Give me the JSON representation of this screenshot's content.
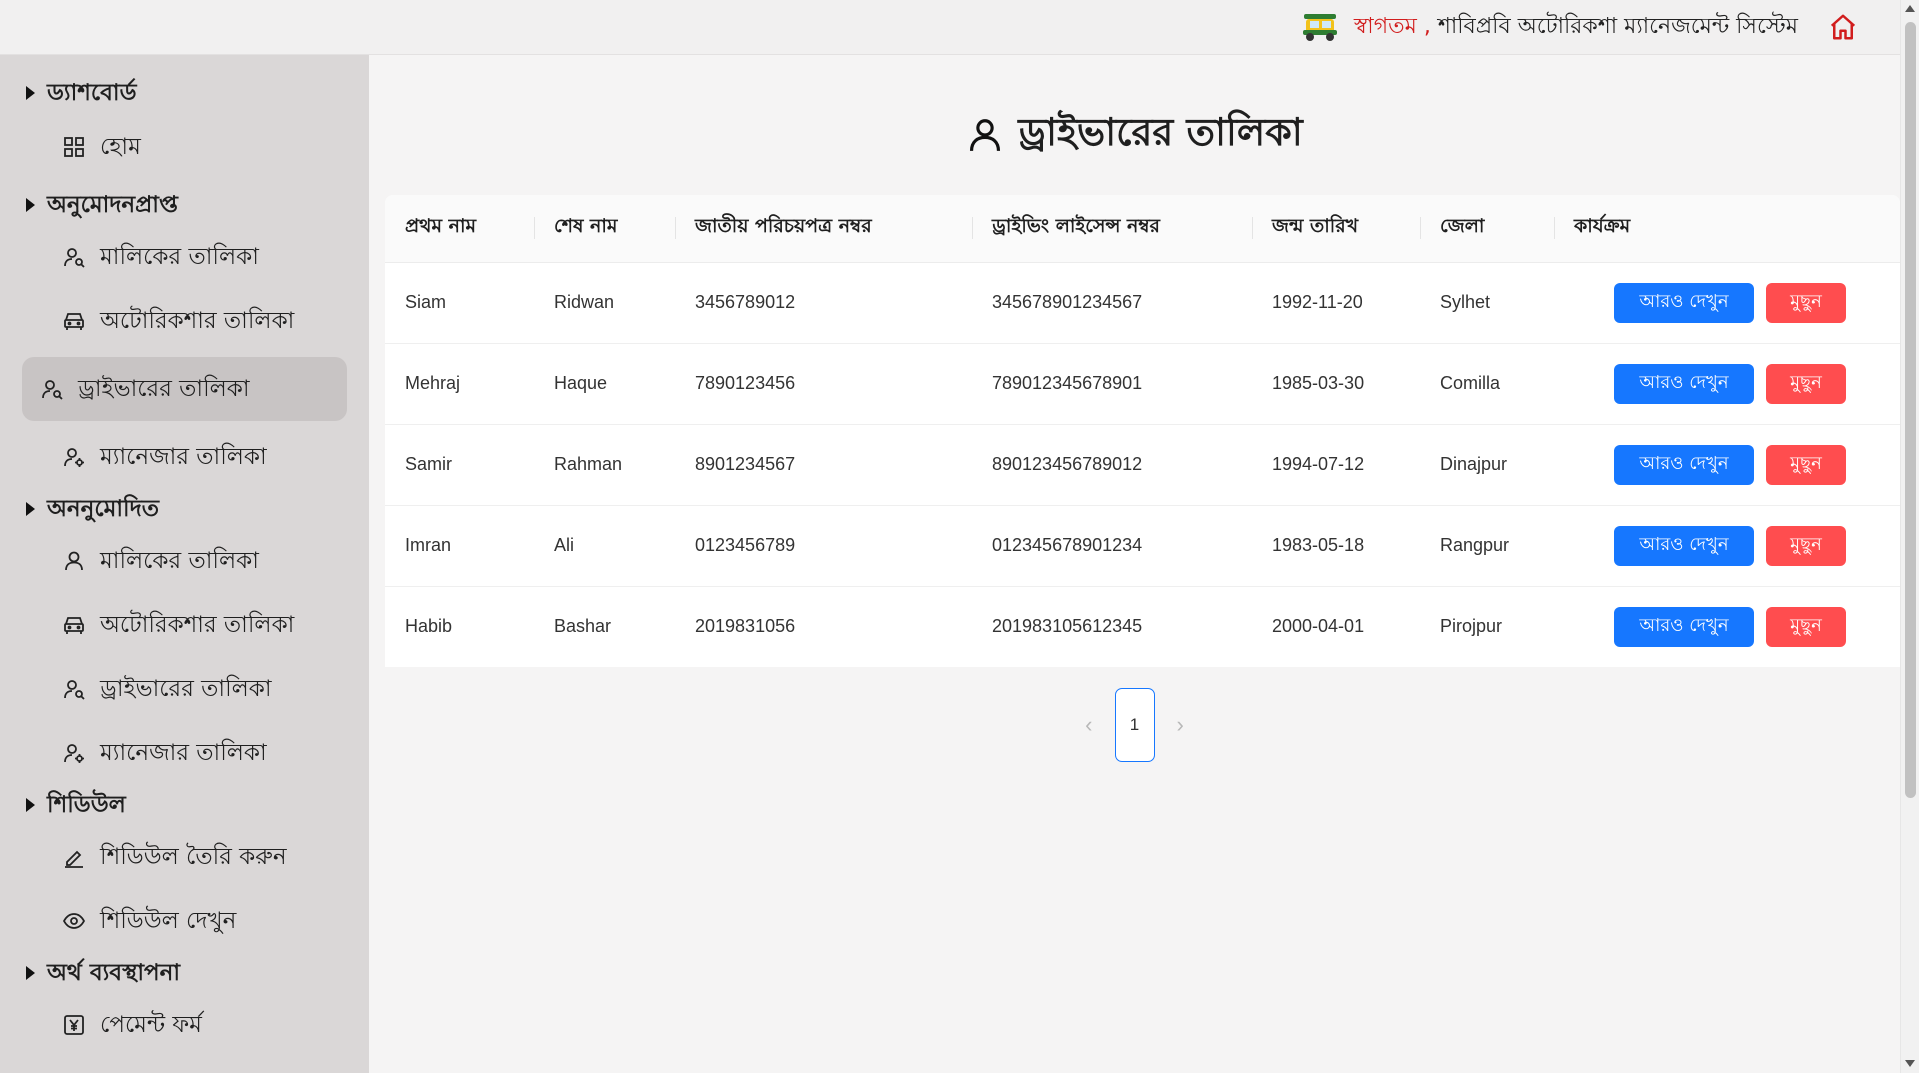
{
  "header": {
    "welcome": "স্বাগতম ,",
    "system_name": "শাবিপ্রবি অটোরিকশা ম্যানেজমেন্ট সিস্টেম",
    "rickshaw_icon": "rickshaw-icon",
    "home_icon": "home-icon",
    "accent_color": "#d11d1d"
  },
  "sidebar": {
    "groups": [
      {
        "title": "ড্যাশবোর্ড",
        "items": [
          {
            "label": "হোম",
            "icon": "grid-icon"
          }
        ]
      },
      {
        "title": "অনুমোদনপ্রাপ্ত",
        "items": [
          {
            "label": "মালিকের তালিকা",
            "icon": "user-search-icon"
          },
          {
            "label": "অটোরিকশার তালিকা",
            "icon": "car-icon"
          },
          {
            "label": "ড্রাইভারের তালিকা",
            "icon": "user-search-icon",
            "active": true
          },
          {
            "label": "ম্যানেজার তালিকা",
            "icon": "user-gear-icon"
          }
        ]
      },
      {
        "title": "অননুমোদিত",
        "items": [
          {
            "label": "মালিকের তালিকা",
            "icon": "user-icon"
          },
          {
            "label": "অটোরিকশার তালিকা",
            "icon": "car-icon"
          },
          {
            "label": "ড্রাইভারের তালিকা",
            "icon": "user-search-icon"
          },
          {
            "label": "ম্যানেজার তালিকা",
            "icon": "user-gear-icon"
          }
        ]
      },
      {
        "title": "শিডিউল",
        "items": [
          {
            "label": "শিডিউল তৈরি করুন",
            "icon": "edit-icon"
          },
          {
            "label": "শিডিউল দেখুন",
            "icon": "eye-icon"
          }
        ]
      },
      {
        "title": "অর্থ ব্যবস্থাপনা",
        "items": [
          {
            "label": "পেমেন্ট ফর্ম",
            "icon": "yen-icon"
          }
        ]
      }
    ]
  },
  "main": {
    "title": "ড্রাইভারের তালিকা",
    "title_icon": "user-icon",
    "columns": [
      "প্রথম নাম",
      "শেষ নাম",
      "জাতীয় পরিচয়পত্র নম্বর",
      "ড্রাইভিং লাইসেন্স নম্বর",
      "জন্ম তারিখ",
      "জেলা",
      "কার্যক্রম"
    ],
    "rows": [
      {
        "first": "Siam",
        "last": "Ridwan",
        "nid": "3456789012",
        "license": "345678901234567",
        "dob": "1992-11-20",
        "district": "Sylhet"
      },
      {
        "first": "Mehraj",
        "last": "Haque",
        "nid": "7890123456",
        "license": "789012345678901",
        "dob": "1985-03-30",
        "district": "Comilla"
      },
      {
        "first": "Samir",
        "last": "Rahman",
        "nid": "8901234567",
        "license": "890123456789012",
        "dob": "1994-07-12",
        "district": "Dinajpur"
      },
      {
        "first": "Imran",
        "last": "Ali",
        "nid": "0123456789",
        "license": "012345678901234",
        "dob": "1983-05-18",
        "district": "Rangpur"
      },
      {
        "first": "Habib",
        "last": "Bashar",
        "nid": "2019831056",
        "license": "201983105612345",
        "dob": "2000-04-01",
        "district": "Pirojpur"
      }
    ],
    "view_label": "আরও দেখুন",
    "delete_label": "মুছুন",
    "view_color": "#1677ff",
    "delete_color": "#ff4d4f"
  },
  "pagination": {
    "current": "1",
    "prev": "‹",
    "next": "›"
  }
}
